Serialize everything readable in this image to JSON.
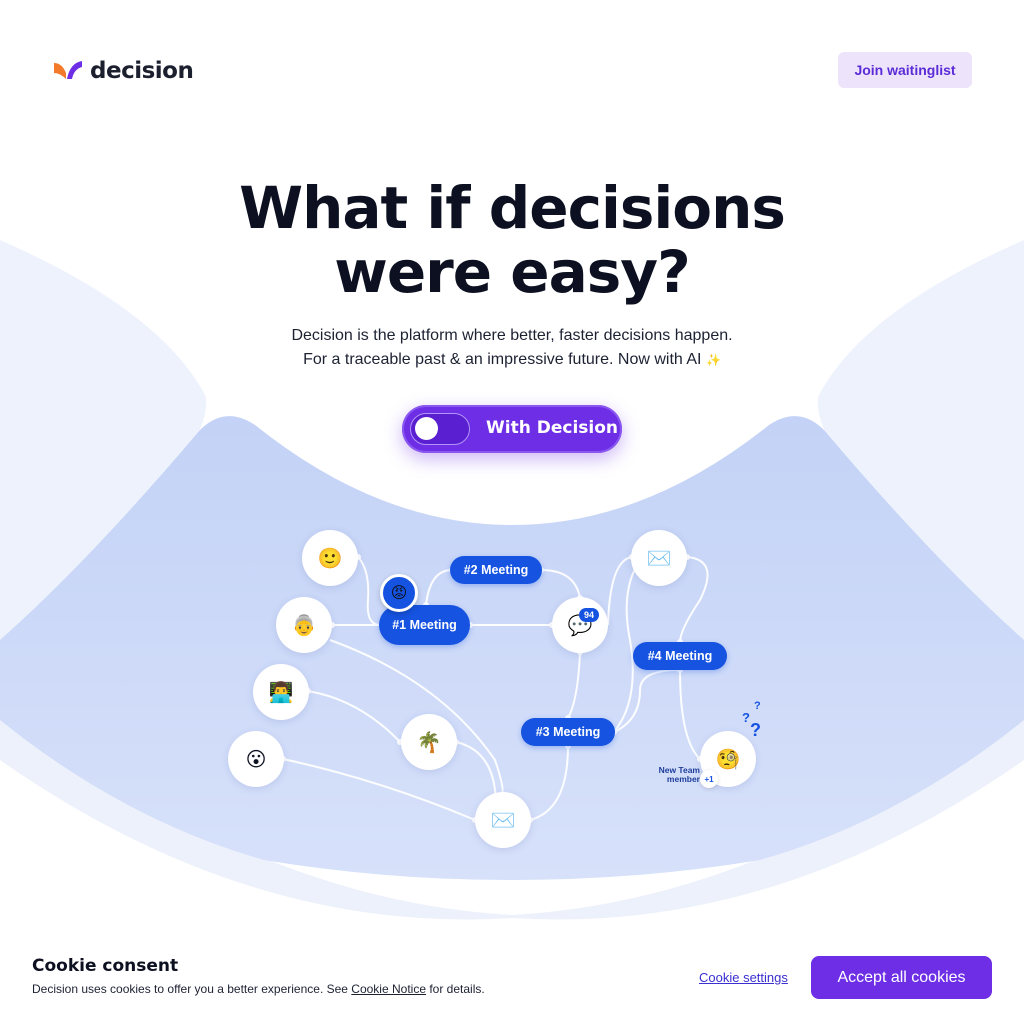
{
  "colors": {
    "brand_purple": "#6d2ee6",
    "accent_blue": "#1553e0",
    "logo_orange": "#f47a2b",
    "waitlist_bg": "#ede4fb",
    "wave_blue": "#c9d6f8"
  },
  "header": {
    "logo_text": "decision",
    "logo_icon": "decision-logo-icon",
    "join_label": "Join waitinglist"
  },
  "hero": {
    "title_line1": "What if decisions",
    "title_line2": "were easy?",
    "subtitle_line1": "Decision is the platform where better, faster decisions happen.",
    "subtitle_line2": "For a traceable past & an impressive future. Now with AI",
    "sparkle": "✨",
    "toggle_label": "With Decision",
    "toggle_on": false
  },
  "diagram": {
    "meetings": [
      "#1 Meeting",
      "#2 Meeting",
      "#3 Meeting",
      "#4 Meeting"
    ],
    "chat_badge": "94",
    "new_member_label_line1": "New Team",
    "new_member_label_line2": "member",
    "plus_one": "+1",
    "nodes": {
      "slight_smile": "🙂",
      "old_woman": "👵",
      "man_technologist": "👨‍💻",
      "hushed": "😮",
      "palm_tree": "🌴",
      "envelope_bottom": "✉️",
      "envelope_top": "✉️",
      "chat": "💬",
      "thinking": "🧐",
      "angry": "😡"
    }
  },
  "cookie": {
    "title": "Cookie consent",
    "text_before": "Decision uses cookies to offer you a better experience. See ",
    "link_label": "Cookie Notice",
    "text_after": " for details.",
    "settings_label": "Cookie settings",
    "accept_label": "Accept all cookies"
  }
}
